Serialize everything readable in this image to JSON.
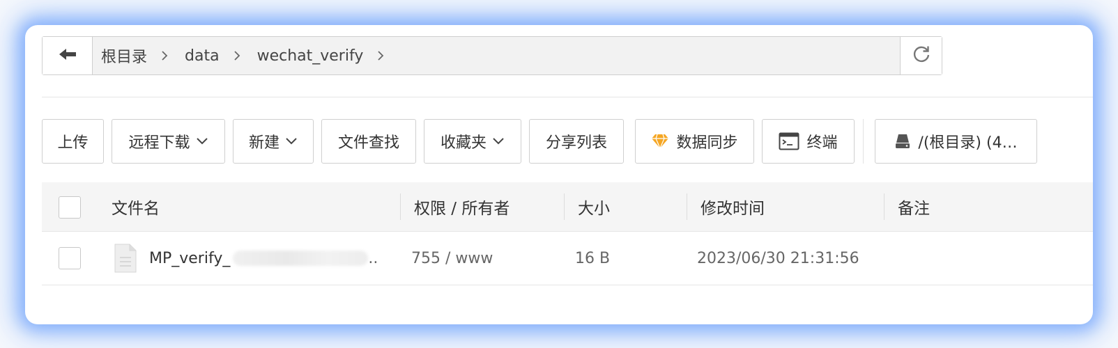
{
  "breadcrumb": {
    "items": [
      "根目录",
      "data",
      "wechat_verify"
    ]
  },
  "toolbar": {
    "upload": "上传",
    "remote_download": "远程下载",
    "new": "新建",
    "file_search": "文件查找",
    "favorites": "收藏夹",
    "share_list": "分享列表",
    "data_sync": "数据同步",
    "terminal": "终端",
    "disk": "/(根目录) (4…"
  },
  "table": {
    "headers": {
      "name": "文件名",
      "perm": "权限 / 所有者",
      "size": "大小",
      "mtime": "修改时间",
      "note": "备注"
    },
    "rows": [
      {
        "name": "MP_verify_",
        "name_suffix": "..",
        "perm": "755 / www",
        "size": "16 B",
        "mtime": "2023/06/30 21:31:56",
        "note": ""
      }
    ]
  },
  "icons": {
    "back": "arrow-left-icon",
    "refresh": "refresh-icon",
    "sync": "diamond-icon",
    "terminal": "terminal-icon",
    "disk": "disk-icon",
    "file": "file-icon"
  },
  "colors": {
    "glow": "#6ea0fa",
    "diamond": "#f5a623",
    "border": "#cfcfcf"
  }
}
